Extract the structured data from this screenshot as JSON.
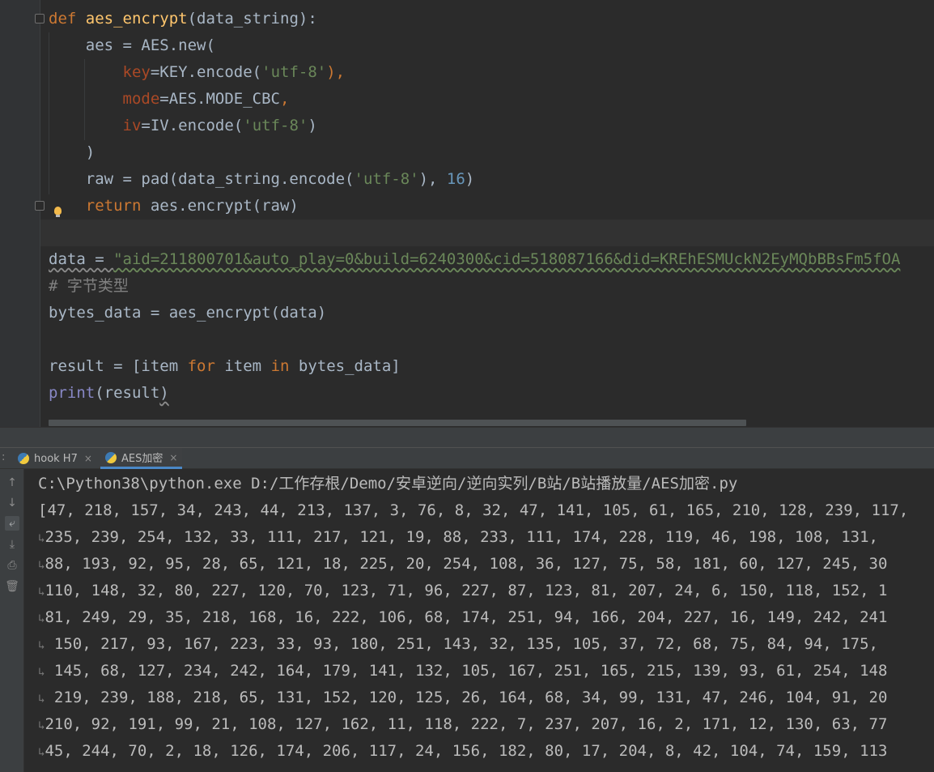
{
  "editor": {
    "lines": [
      {
        "tokens": [
          {
            "t": "def ",
            "c": "kw"
          },
          {
            "t": "aes_encrypt",
            "c": "fn"
          },
          {
            "t": "(data_string):",
            "c": ""
          }
        ]
      },
      {
        "tokens": [
          {
            "t": "    aes = AES.new(",
            "c": ""
          }
        ]
      },
      {
        "tokens": [
          {
            "t": "        ",
            "c": ""
          },
          {
            "t": "key",
            "c": "param"
          },
          {
            "t": "=KEY.encode(",
            "c": ""
          },
          {
            "t": "'utf-8'",
            "c": "str"
          },
          {
            "t": "),",
            "c": "kw"
          }
        ]
      },
      {
        "tokens": [
          {
            "t": "        ",
            "c": ""
          },
          {
            "t": "mode",
            "c": "param"
          },
          {
            "t": "=AES.MODE_CBC",
            "c": ""
          },
          {
            "t": ",",
            "c": "kw"
          }
        ]
      },
      {
        "tokens": [
          {
            "t": "        ",
            "c": ""
          },
          {
            "t": "iv",
            "c": "param"
          },
          {
            "t": "=IV.encode(",
            "c": ""
          },
          {
            "t": "'utf-8'",
            "c": "str"
          },
          {
            "t": ")",
            "c": ""
          }
        ]
      },
      {
        "tokens": [
          {
            "t": "    )",
            "c": ""
          }
        ]
      },
      {
        "tokens": [
          {
            "t": "    raw = pad(data_string.encode(",
            "c": ""
          },
          {
            "t": "'utf-8'",
            "c": "str"
          },
          {
            "t": "), ",
            "c": ""
          },
          {
            "t": "16",
            "c": "num"
          },
          {
            "t": ")",
            "c": ""
          }
        ]
      },
      {
        "tokens": [
          {
            "t": "    ",
            "c": ""
          },
          {
            "t": "return ",
            "c": "kw"
          },
          {
            "t": "aes.encrypt(raw)",
            "c": ""
          }
        ]
      },
      {
        "tokens": []
      },
      {
        "tokens": [
          {
            "t": "data = ",
            "c": "squiggle-gray"
          },
          {
            "t": "\"aid=211800701&auto_play=0&build=6240300&cid=518087166&did=KREhESMUckN2EyMQbBBsFm5fOA",
            "c": "str squiggle"
          }
        ]
      },
      {
        "tokens": [
          {
            "t": "# 字节类型",
            "c": "cmt"
          }
        ]
      },
      {
        "tokens": [
          {
            "t": "bytes_data = aes_encrypt(data)",
            "c": ""
          }
        ]
      },
      {
        "tokens": []
      },
      {
        "tokens": [
          {
            "t": "result = [item ",
            "c": ""
          },
          {
            "t": "for ",
            "c": "kw"
          },
          {
            "t": "item ",
            "c": ""
          },
          {
            "t": "in ",
            "c": "kw"
          },
          {
            "t": "bytes_data]",
            "c": ""
          }
        ]
      },
      {
        "tokens": [
          {
            "t": "print",
            "c": "bi"
          },
          {
            "t": "(result",
            "c": ""
          },
          {
            "t": ")",
            "c": "squiggle-gray"
          }
        ]
      }
    ]
  },
  "run_panel": {
    "tabs": [
      {
        "label": "hook H7",
        "active": false
      },
      {
        "label": "AES加密",
        "active": true
      }
    ],
    "tab_close_glyph": "×",
    "tab_separator": ":",
    "toolbar_icons": [
      "arrow-up-icon",
      "arrow-down-icon",
      "soft-wrap-icon",
      "scroll-to-end-icon",
      "print-icon",
      "trash-icon"
    ],
    "command": "C:\\Python38\\python.exe D:/工作存根/Demo/安卓逆向/逆向实列/B站/B站播放量/AES加密.py",
    "output_lines": [
      {
        "wrap": false,
        "text": "[47, 218, 157, 34, 243, 44, 213, 137, 3, 76, 8, 32, 47, 141, 105, 61, 165, 210, 128, 239, 117,"
      },
      {
        "wrap": true,
        "text": "235, 239, 254, 132, 33, 111, 217, 121, 19, 88, 233, 111, 174, 228, 119, 46, 198, 108, 131,"
      },
      {
        "wrap": true,
        "text": "88, 193, 92, 95, 28, 65, 121, 18, 225, 20, 254, 108, 36, 127, 75, 58, 181, 60, 127, 245, 30"
      },
      {
        "wrap": true,
        "text": "110, 148, 32, 80, 227, 120, 70, 123, 71, 96, 227, 87, 123, 81, 207, 24, 6, 150, 118, 152, 1"
      },
      {
        "wrap": true,
        "text": "81, 249, 29, 35, 218, 168, 16, 222, 106, 68, 174, 251, 94, 166, 204, 227, 16, 149, 242, 241"
      },
      {
        "wrap": true,
        "text": " 150, 217, 93, 167, 223, 33, 93, 180, 251, 143, 32, 135, 105, 37, 72, 68, 75, 84, 94, 175,"
      },
      {
        "wrap": true,
        "text": " 145, 68, 127, 234, 242, 164, 179, 141, 132, 105, 167, 251, 165, 215, 139, 93, 61, 254, 148"
      },
      {
        "wrap": true,
        "text": " 219, 239, 188, 218, 65, 131, 152, 120, 125, 26, 164, 68, 34, 99, 131, 47, 246, 104, 91, 20"
      },
      {
        "wrap": true,
        "text": "210, 92, 191, 99, 21, 108, 127, 162, 11, 118, 222, 7, 237, 207, 16, 2, 171, 12, 130, 63, 77"
      },
      {
        "wrap": true,
        "text": "45, 244, 70, 2, 18, 126, 174, 206, 117, 24, 156, 182, 80, 17, 204, 8, 42, 104, 74, 159, 113"
      }
    ],
    "wrap_glyph": "↳"
  }
}
